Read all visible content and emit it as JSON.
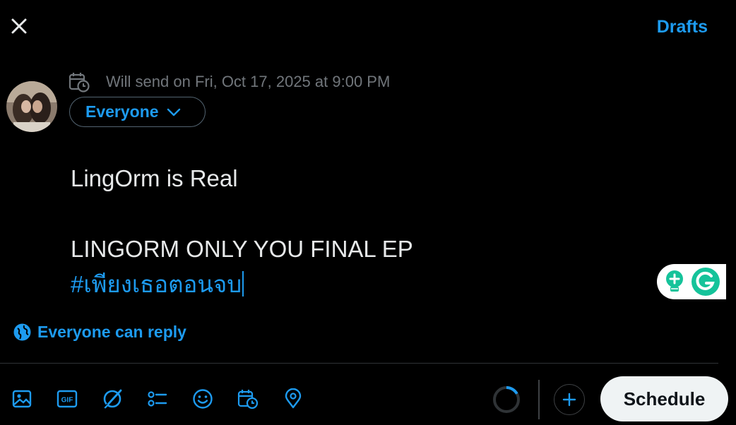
{
  "header": {
    "drafts_label": "Drafts"
  },
  "schedule": {
    "text": "Will send on Fri, Oct 17, 2025 at 9:00 PM"
  },
  "audience": {
    "label": "Everyone"
  },
  "compose": {
    "line1": "LingOrm is Real",
    "line2": "",
    "line3": "LINGORM ONLY YOU FINAL EP",
    "hashtag": "#เพียงเธอตอนจบ"
  },
  "reply_setting": {
    "label": "Everyone can reply"
  },
  "toolbar": {
    "icons": [
      "image-icon",
      "gif-icon",
      "grok-icon",
      "poll-icon",
      "emoji-icon",
      "schedule-icon",
      "location-icon"
    ]
  },
  "actions": {
    "schedule_button": "Schedule"
  },
  "colors": {
    "accent": "#1d9bf0",
    "muted": "#71767b",
    "background": "#000000",
    "button_bg": "#eff3f4",
    "grammarly": "#15c39a"
  }
}
